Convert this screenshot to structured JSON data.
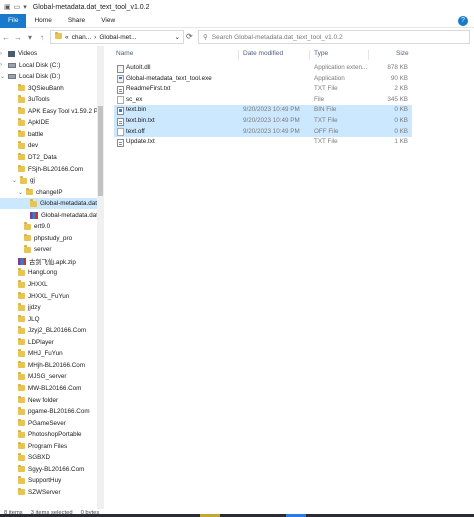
{
  "window": {
    "title": "Global-metadata.dat_text_tool_v1.0.2"
  },
  "ribbon": {
    "tabs": [
      "File",
      "Home",
      "Share",
      "View"
    ]
  },
  "address": {
    "segments": [
      "chan...",
      "Global-met..."
    ],
    "search_placeholder": "Search Global-metadata.dat_text_tool_v1.0.2"
  },
  "nav": {
    "items": [
      {
        "label": "Videos",
        "icon": "videos-icon"
      },
      {
        "label": "Local Disk (C:)",
        "icon": "disk-icon"
      },
      {
        "label": "Local Disk (D:)",
        "icon": "disk-icon"
      },
      {
        "label": "3QSieuBanh",
        "icon": "folder-icon"
      },
      {
        "label": "3uTools",
        "icon": "folder-icon"
      },
      {
        "label": "APK Easy Tool v1.59.2 Por",
        "icon": "folder-icon"
      },
      {
        "label": "ApkIDE",
        "icon": "folder-icon"
      },
      {
        "label": "battle",
        "icon": "folder-icon"
      },
      {
        "label": "dev",
        "icon": "folder-icon"
      },
      {
        "label": "DT2_Data",
        "icon": "folder-icon"
      },
      {
        "label": "FSjh-BL20166.Com",
        "icon": "folder-icon"
      },
      {
        "label": "gj",
        "icon": "folder-icon"
      },
      {
        "label": "changeIP",
        "icon": "folder-icon"
      },
      {
        "label": "Global-metadata.dat_t",
        "icon": "folder-icon"
      },
      {
        "label": "Global-metadata.dat_t",
        "icon": "archive-icon"
      },
      {
        "label": "ert9.0",
        "icon": "folder-icon"
      },
      {
        "label": "phpstudy_pro",
        "icon": "folder-icon"
      },
      {
        "label": "server",
        "icon": "folder-icon"
      },
      {
        "label": "古剑飞仙.apk.zip",
        "icon": "archive-icon"
      },
      {
        "label": "HangLong",
        "icon": "folder-icon"
      },
      {
        "label": "JHXXL",
        "icon": "folder-icon"
      },
      {
        "label": "JHXXL_FuYun",
        "icon": "folder-icon"
      },
      {
        "label": "jjdzy",
        "icon": "folder-icon"
      },
      {
        "label": "JLQ",
        "icon": "folder-icon"
      },
      {
        "label": "Jzyj2_BL20166.Com",
        "icon": "folder-icon"
      },
      {
        "label": "LDPlayer",
        "icon": "folder-icon"
      },
      {
        "label": "MHJ_FuYun",
        "icon": "folder-icon"
      },
      {
        "label": "MHjh-BL20166.Com",
        "icon": "folder-icon"
      },
      {
        "label": "MJSG_server",
        "icon": "folder-icon"
      },
      {
        "label": "MW-BL20166.Com",
        "icon": "folder-icon"
      },
      {
        "label": "New folder",
        "icon": "folder-icon"
      },
      {
        "label": "pgame-BL20166.Com",
        "icon": "folder-icon"
      },
      {
        "label": "PGameSever",
        "icon": "folder-icon"
      },
      {
        "label": "PhotoshopPortable",
        "icon": "folder-icon"
      },
      {
        "label": "Program Files",
        "icon": "folder-icon"
      },
      {
        "label": "SGBXD",
        "icon": "folder-icon"
      },
      {
        "label": "Sgyy-BL20166.Com",
        "icon": "folder-icon"
      },
      {
        "label": "SupportHuy",
        "icon": "folder-icon"
      },
      {
        "label": "SZWServer",
        "icon": "folder-icon"
      }
    ]
  },
  "files": {
    "columns": [
      "Name",
      "Date modified",
      "Type",
      "Size"
    ],
    "rows": [
      {
        "name": "AutoIt.dll",
        "date": "",
        "type": "Application exten...",
        "size": "878 KB",
        "icon": "dll-icon",
        "selected": false
      },
      {
        "name": "Global-metadata_text_tool.exe",
        "date": "",
        "type": "Application",
        "size": "90 KB",
        "icon": "exe-icon",
        "selected": false
      },
      {
        "name": "ReadmeFirst.txt",
        "date": "",
        "type": "TXT File",
        "size": "2 KB",
        "icon": "txt-icon",
        "selected": false
      },
      {
        "name": "sc_ex",
        "date": "",
        "type": "File",
        "size": "345 KB",
        "icon": "file-icon",
        "selected": false
      },
      {
        "name": "text.bin",
        "date": "9/20/2023 10:49 PM",
        "type": "BIN File",
        "size": "0 KB",
        "icon": "bin-icon",
        "selected": true
      },
      {
        "name": "text.bin.txt",
        "date": "9/20/2023 10:49 PM",
        "type": "TXT File",
        "size": "0 KB",
        "icon": "txt-icon",
        "selected": true
      },
      {
        "name": "text.off",
        "date": "9/20/2023 10:49 PM",
        "type": "OFF File",
        "size": "0 KB",
        "icon": "file-icon",
        "selected": true
      },
      {
        "name": "Update.txt",
        "date": "",
        "type": "TXT File",
        "size": "1 KB",
        "icon": "txt-icon",
        "selected": false
      }
    ]
  },
  "status": {
    "items": "8 items",
    "selected": "3 items selected",
    "size": "0 bytes"
  },
  "colors": {
    "accent": "#1979ca",
    "selection": "#cce8ff"
  }
}
